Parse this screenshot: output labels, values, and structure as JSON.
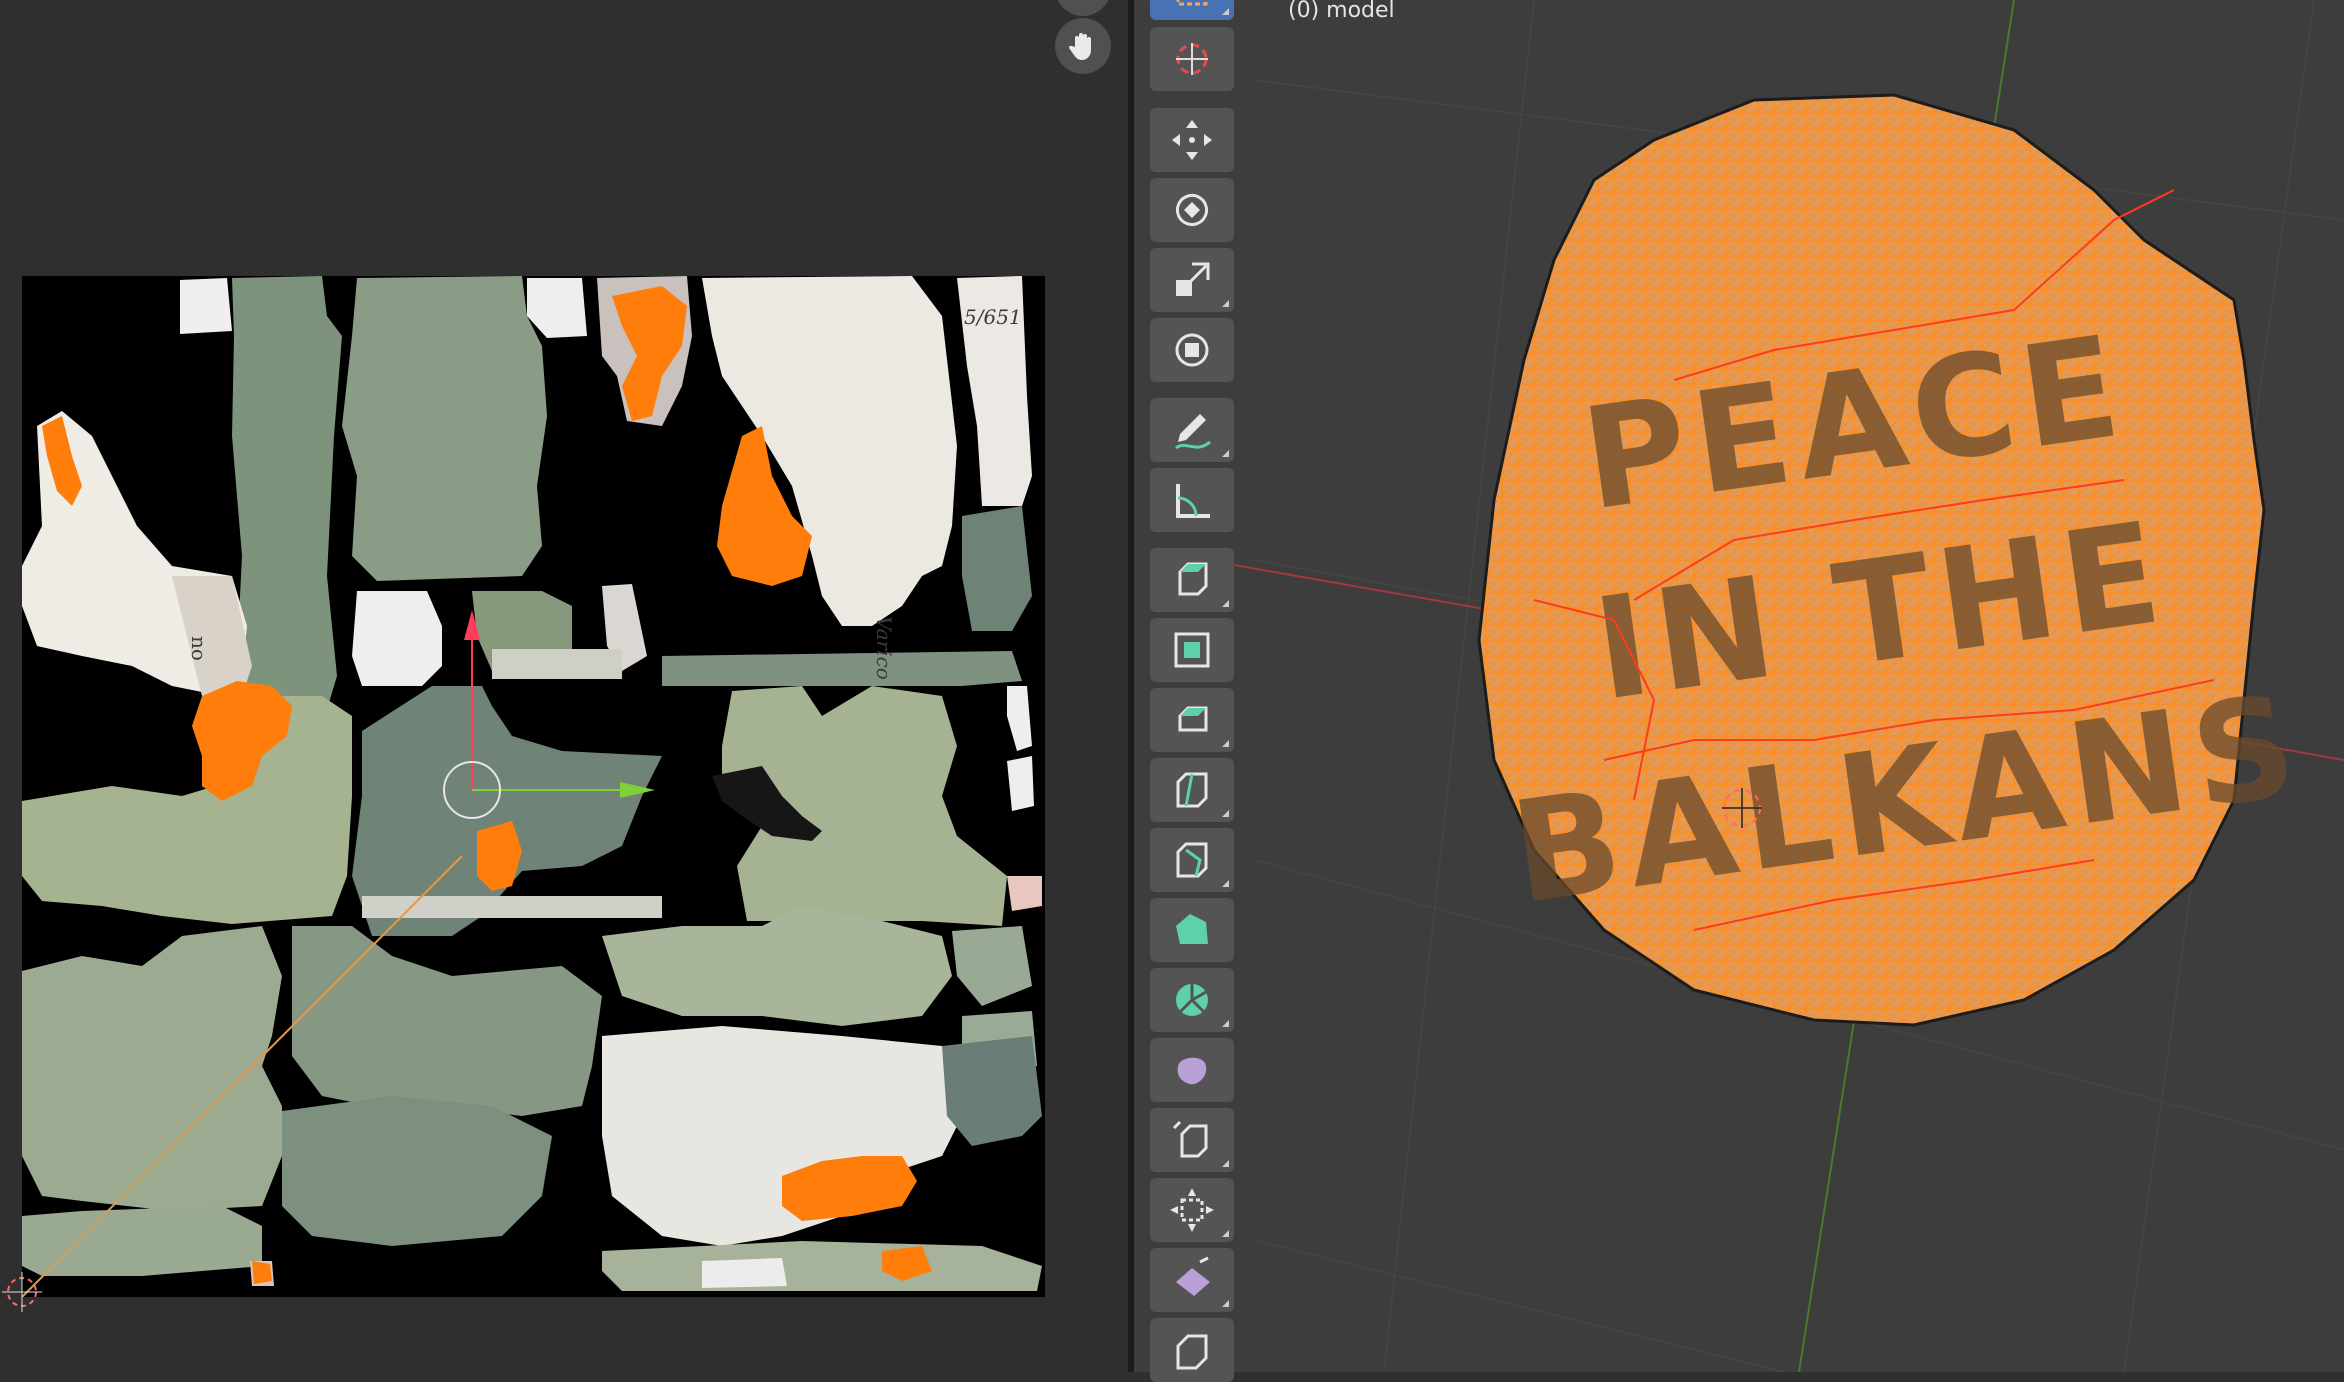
{
  "viewport": {
    "object_label": "(0) model"
  },
  "uv_editor": {
    "nav_buttons": [
      "zoom-icon",
      "hand-pan-icon"
    ],
    "image_notes": [
      "5/651",
      "Varico",
      "no"
    ]
  },
  "toolbar": {
    "tools": [
      {
        "name": "select-box",
        "icon": "select-box-icon",
        "active": true
      },
      {
        "name": "cursor",
        "icon": "cursor-icon"
      },
      {
        "name": "move",
        "icon": "move-icon"
      },
      {
        "name": "rotate",
        "icon": "rotate-icon"
      },
      {
        "name": "scale",
        "icon": "scale-icon"
      },
      {
        "name": "transform",
        "icon": "transform-icon"
      },
      {
        "name": "annotate",
        "icon": "annotate-icon"
      },
      {
        "name": "measure",
        "icon": "measure-icon"
      },
      {
        "name": "extrude-region",
        "icon": "extrude-icon"
      },
      {
        "name": "inset-faces",
        "icon": "inset-icon"
      },
      {
        "name": "bevel",
        "icon": "bevel-icon"
      },
      {
        "name": "loop-cut",
        "icon": "loop-cut-icon"
      },
      {
        "name": "knife",
        "icon": "knife-icon"
      },
      {
        "name": "poly-build",
        "icon": "poly-build-icon"
      },
      {
        "name": "spin",
        "icon": "spin-icon"
      },
      {
        "name": "smooth",
        "icon": "smooth-icon"
      },
      {
        "name": "edge-slide",
        "icon": "edge-slide-icon"
      },
      {
        "name": "shrink-fatten",
        "icon": "shrink-fatten-icon"
      },
      {
        "name": "shear",
        "icon": "shear-icon"
      },
      {
        "name": "rip-region",
        "icon": "rip-icon"
      }
    ]
  },
  "colors": {
    "background": "#303030",
    "viewport_bg": "#3d3d3d",
    "button": "#545454",
    "active": "#4772b3",
    "selection": "#ff8c1a",
    "uv_green": "#8d9f86",
    "paper": "#ece8e0"
  },
  "mesh_text": [
    "PEACE",
    "IN THE",
    "BALKANS"
  ]
}
